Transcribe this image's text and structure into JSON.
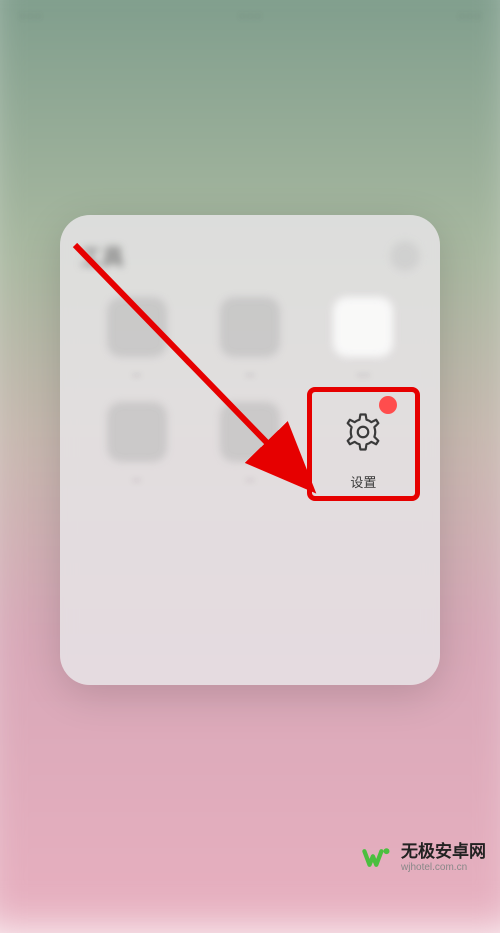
{
  "status": {
    "left": "· · ·",
    "time": "· · ·",
    "right": "· · ·"
  },
  "folder": {
    "title": "工具",
    "apps": [
      {
        "label": "··",
        "icon": "app-icon-1"
      },
      {
        "label": "··",
        "icon": "app-icon-2"
      },
      {
        "label": "···",
        "icon": "app-icon-3"
      },
      {
        "label": "··",
        "icon": "app-icon-4"
      },
      {
        "label": "··",
        "icon": "app-icon-5"
      },
      {
        "label": "设置",
        "icon": "settings",
        "highlighted": true
      }
    ]
  },
  "highlight": {
    "target_index": 5,
    "color": "#e60000"
  },
  "watermark": {
    "name": "无极安卓网",
    "url": "wjhotel.com.cn"
  }
}
